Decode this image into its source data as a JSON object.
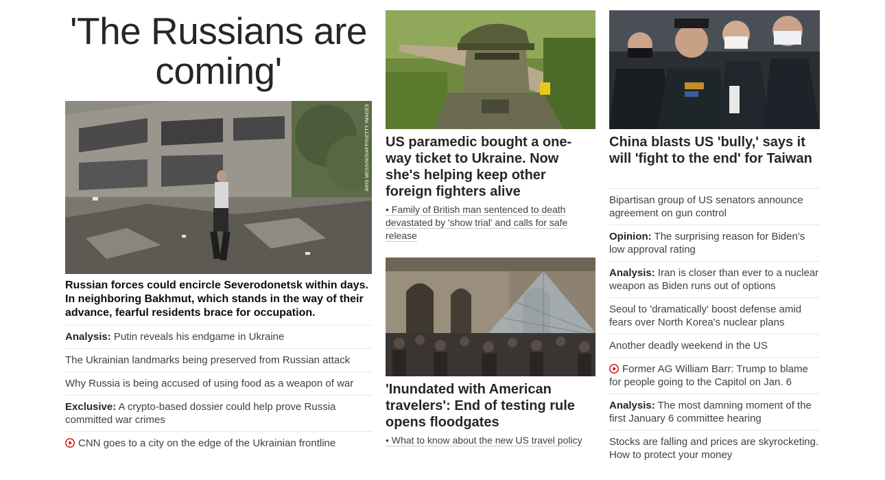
{
  "left": {
    "headline": "'The Russians are coming'",
    "photo_credit": "ARIS MESSINIS/AFP/GETTY IMAGES",
    "summary": "Russian forces could encircle Severodonetsk within days. In neighboring Bakhmut, which stands in the way of their advance, fearful residents brace for occupation.",
    "items": [
      {
        "prefix": "Analysis:",
        "text": " Putin reveals his endgame in Ukraine"
      },
      {
        "prefix": "",
        "text": "The Ukrainian landmarks being preserved from Russian attack"
      },
      {
        "prefix": "",
        "text": "Why Russia is being accused of using food as a weapon of war"
      },
      {
        "prefix": "Exclusive:",
        "text": " A crypto-based dossier could help prove Russia committed war crimes"
      },
      {
        "prefix": "",
        "text": "CNN goes to a city on the edge of the Ukrainian frontline",
        "video": true
      }
    ]
  },
  "middle": {
    "card1_title": "US paramedic bought a one-way ticket to Ukraine. Now she's helping keep other foreign fighters alive",
    "card1_related": "• Family of British man sentenced to death devastated by 'show trial' and calls for safe release",
    "card2_title": "'Inundated with American travelers': End of testing rule opens floodgates",
    "card2_related": "• What to know about the new US travel policy"
  },
  "right": {
    "card_title": "China blasts US 'bully,' says it will 'fight to the end' for Taiwan",
    "items": [
      {
        "prefix": "",
        "text": "Bipartisan group of US senators announce agreement on gun control"
      },
      {
        "prefix": "Opinion:",
        "text": " The surprising reason for Biden's low approval rating"
      },
      {
        "prefix": "Analysis:",
        "text": " Iran is closer than ever to a nuclear weapon as Biden runs out of options"
      },
      {
        "prefix": "",
        "text": "Seoul to 'dramatically' boost defense amid fears over North Korea's nuclear plans"
      },
      {
        "prefix": "",
        "text": "Another deadly weekend in the US"
      },
      {
        "prefix": "",
        "text": "Former AG William Barr: Trump to blame for people going to the Capitol on Jan. 6",
        "video": true
      },
      {
        "prefix": "Analysis:",
        "text": " The most damning moment of the first January 6 committee hearing"
      },
      {
        "prefix": "",
        "text": "Stocks are falling and prices are skyrocketing. How to protect your money"
      }
    ]
  },
  "colors": {
    "video_icon": "#cc0000",
    "divider": "#e6e6e6"
  }
}
